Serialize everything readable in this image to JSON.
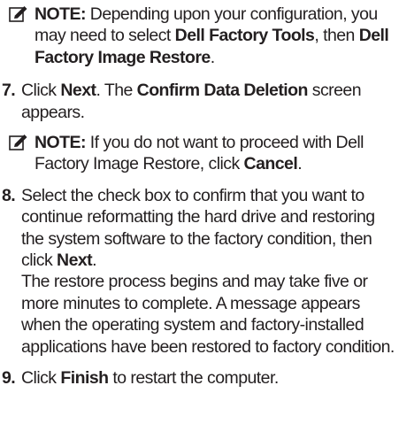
{
  "note1": {
    "label": "NOTE:",
    "t1": " Depending upon your configuration, you may need to select ",
    "b1": "Dell Factory Tools",
    "t2": ", then ",
    "b2": "Dell Factory Image Restore",
    "t3": "."
  },
  "step7": {
    "num": "7.",
    "t1": "Click ",
    "b1": "Next",
    "t2": ". The ",
    "b2": "Confirm Data Deletion",
    "t3": " screen appears."
  },
  "note2": {
    "label": "NOTE:",
    "t1": " If you do not want to proceed with Dell Factory Image Restore, click ",
    "b1": "Cancel",
    "t2": "."
  },
  "step8": {
    "num": "8.",
    "t1": "Select the check box to confirm that you want to continue reformatting the hard drive and restoring the system software to the factory condition, then click ",
    "b1": "Next",
    "t2": ".",
    "t3": "The restore process begins and may take five or more minutes to complete. A message appears when the operating system and factory-installed applications have been restored to factory condition."
  },
  "step9": {
    "num": "9.",
    "t1": "Click ",
    "b1": "Finish",
    "t2": " to restart the computer."
  }
}
